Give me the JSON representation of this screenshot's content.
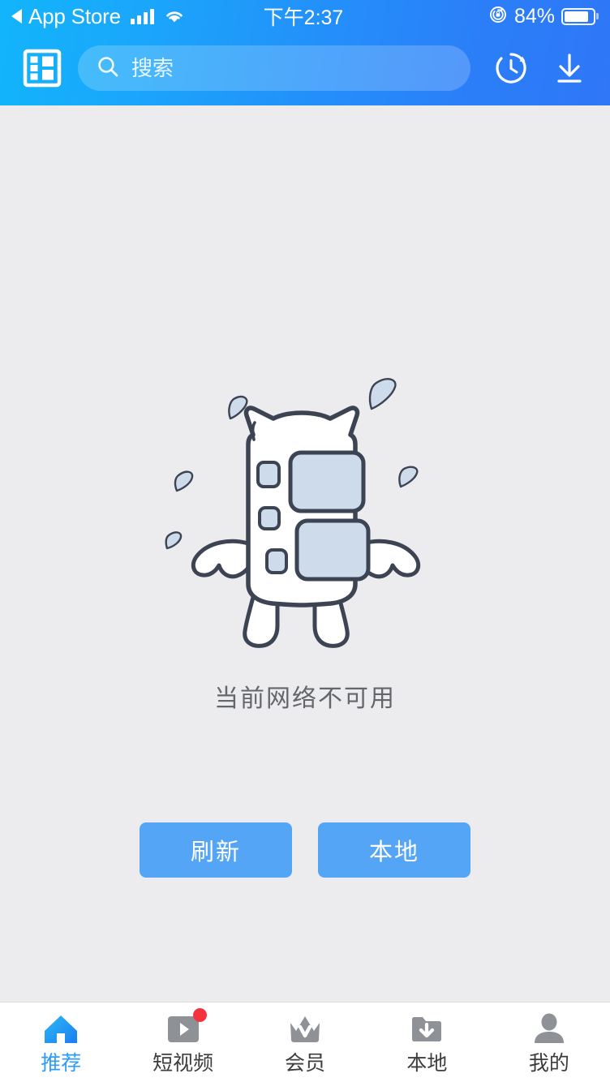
{
  "status_bar": {
    "back_label": "App Store",
    "back_icon": "back-triangle-icon",
    "signal_icon": "cellular-signal-icon",
    "wifi_icon": "wifi-icon",
    "time": "下午2:37",
    "rotation_lock_icon": "rotation-lock-icon",
    "battery_percent": "84%",
    "battery_icon": "battery-icon",
    "battery_level": 84
  },
  "app_bar": {
    "logo_icon": "film-grid-logo-icon",
    "search": {
      "icon": "search-icon",
      "placeholder": "搜索",
      "value": ""
    },
    "history_icon": "history-clock-icon",
    "download_icon": "download-arrow-icon"
  },
  "main": {
    "illustration": "network-error-mascot-illustration",
    "message": "当前网络不可用",
    "buttons": [
      {
        "name": "refresh-button",
        "label": "刷新"
      },
      {
        "name": "local-button",
        "label": "本地"
      }
    ]
  },
  "tabbar": {
    "items": [
      {
        "name": "tab-recommend",
        "label": "推荐",
        "icon": "home-icon",
        "active": true,
        "badge": false
      },
      {
        "name": "tab-short-video",
        "label": "短视频",
        "icon": "play-video-icon",
        "active": false,
        "badge": true
      },
      {
        "name": "tab-member",
        "label": "会员",
        "icon": "crown-vip-icon",
        "active": false,
        "badge": false
      },
      {
        "name": "tab-local",
        "label": "本地",
        "icon": "folder-download-icon",
        "active": false,
        "badge": false
      },
      {
        "name": "tab-mine",
        "label": "我的",
        "icon": "person-icon",
        "active": false,
        "badge": false
      }
    ]
  },
  "colors": {
    "header_gradient_start": "#12b5fb",
    "header_gradient_end": "#2f77f7",
    "page_background": "#ececee",
    "button_blue": "#55a5f7",
    "active_tab_blue": "#2f9bf5",
    "inactive_icon_gray": "#8e9196",
    "badge_red": "#f5333f",
    "message_text": "#63666b"
  }
}
